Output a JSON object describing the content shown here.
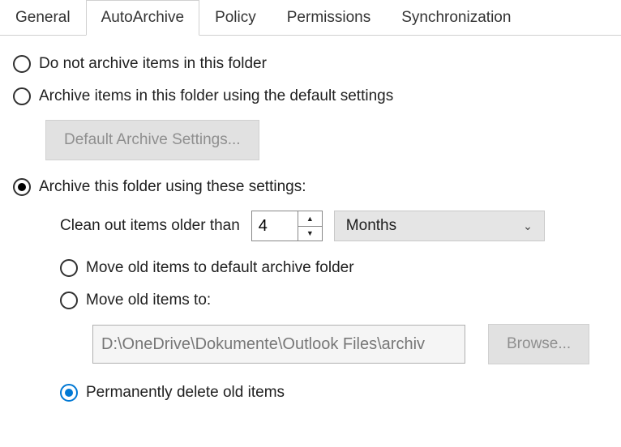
{
  "tabs": {
    "general": "General",
    "autoarchive": "AutoArchive",
    "policy": "Policy",
    "permissions": "Permissions",
    "synchronization": "Synchronization"
  },
  "options": {
    "do_not_archive": "Do not archive items in this folder",
    "use_default": "Archive items in this folder using the default settings",
    "use_these": "Archive this folder using these settings:"
  },
  "buttons": {
    "default_settings": "Default Archive Settings...",
    "browse": "Browse..."
  },
  "cleanout": {
    "label": "Clean out items older than",
    "value": "4",
    "unit": "Months"
  },
  "actions": {
    "move_default": "Move old items to default archive folder",
    "move_to": "Move old items to:",
    "path": "D:\\OneDrive\\Dokumente\\Outlook Files\\archiv",
    "perm_delete": "Permanently delete old items"
  }
}
